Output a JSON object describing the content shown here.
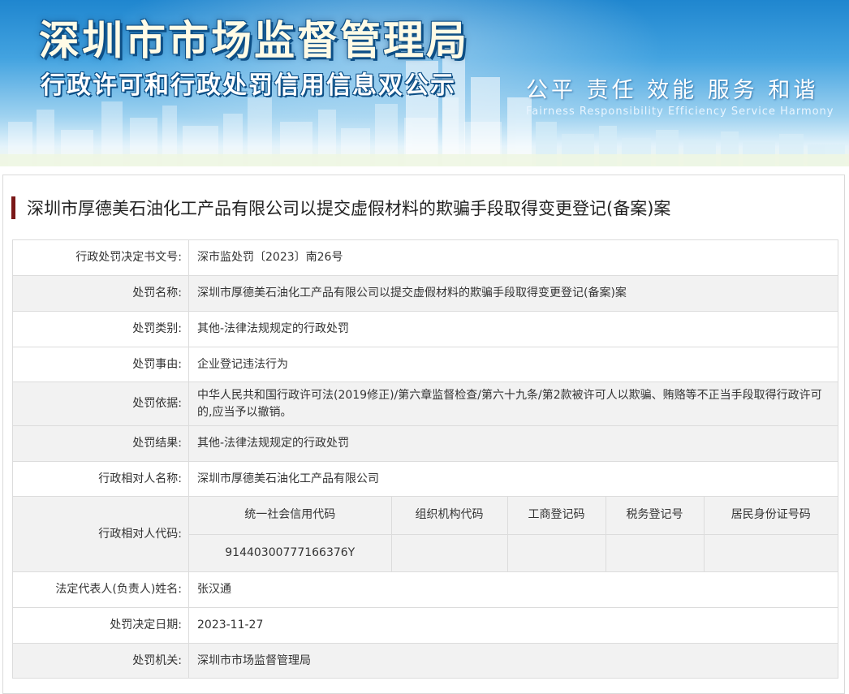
{
  "banner": {
    "title": "深圳市市场监督管理局",
    "subtitle": "行政许可和行政处罚信用信息双公示",
    "slogan_cn": "公平  责任  效能  服务  和谐",
    "slogan_en": "Fairness  Responsibility  Efficiency  Service  Harmony"
  },
  "case": {
    "heading": "深圳市厚德美石油化工产品有限公司以提交虚假材料的欺骗手段取得变更登记(备案)案"
  },
  "rows": [
    {
      "label": "行政处罚决定书文号:",
      "value": "深市监处罚〔2023〕南26号"
    },
    {
      "label": "处罚名称:",
      "value": "深圳市厚德美石油化工产品有限公司以提交虚假材料的欺骗手段取得变更登记(备案)案"
    },
    {
      "label": "处罚类别:",
      "value": "其他-法律法规规定的行政处罚"
    },
    {
      "label": "处罚事由:",
      "value": "企业登记违法行为"
    },
    {
      "label": "处罚依据:",
      "value": "中华人民共和国行政许可法(2019修正)/第六章监督检查/第六十九条/第2款被许可人以欺骗、贿赂等不正当手段取得行政许可的,应当予以撤销。"
    },
    {
      "label": "处罚结果:",
      "value": "其他-法律法规规定的行政处罚"
    },
    {
      "label": "行政相对人名称:",
      "value": "深圳市厚德美石油化工产品有限公司"
    }
  ],
  "codes": {
    "label": "行政相对人代码:",
    "headers": [
      "统一社会信用代码",
      "组织机构代码",
      "工商登记码",
      "税务登记号",
      "居民身份证号码"
    ],
    "values": [
      "91440300777166376Y",
      "",
      "",
      "",
      ""
    ]
  },
  "rows_after": [
    {
      "label": "法定代表人(负责人)姓名:",
      "value": "张汉通"
    },
    {
      "label": "处罚决定日期:",
      "value": "2023-11-27"
    },
    {
      "label": "处罚机关:",
      "value": "深圳市市场监督管理局"
    }
  ]
}
